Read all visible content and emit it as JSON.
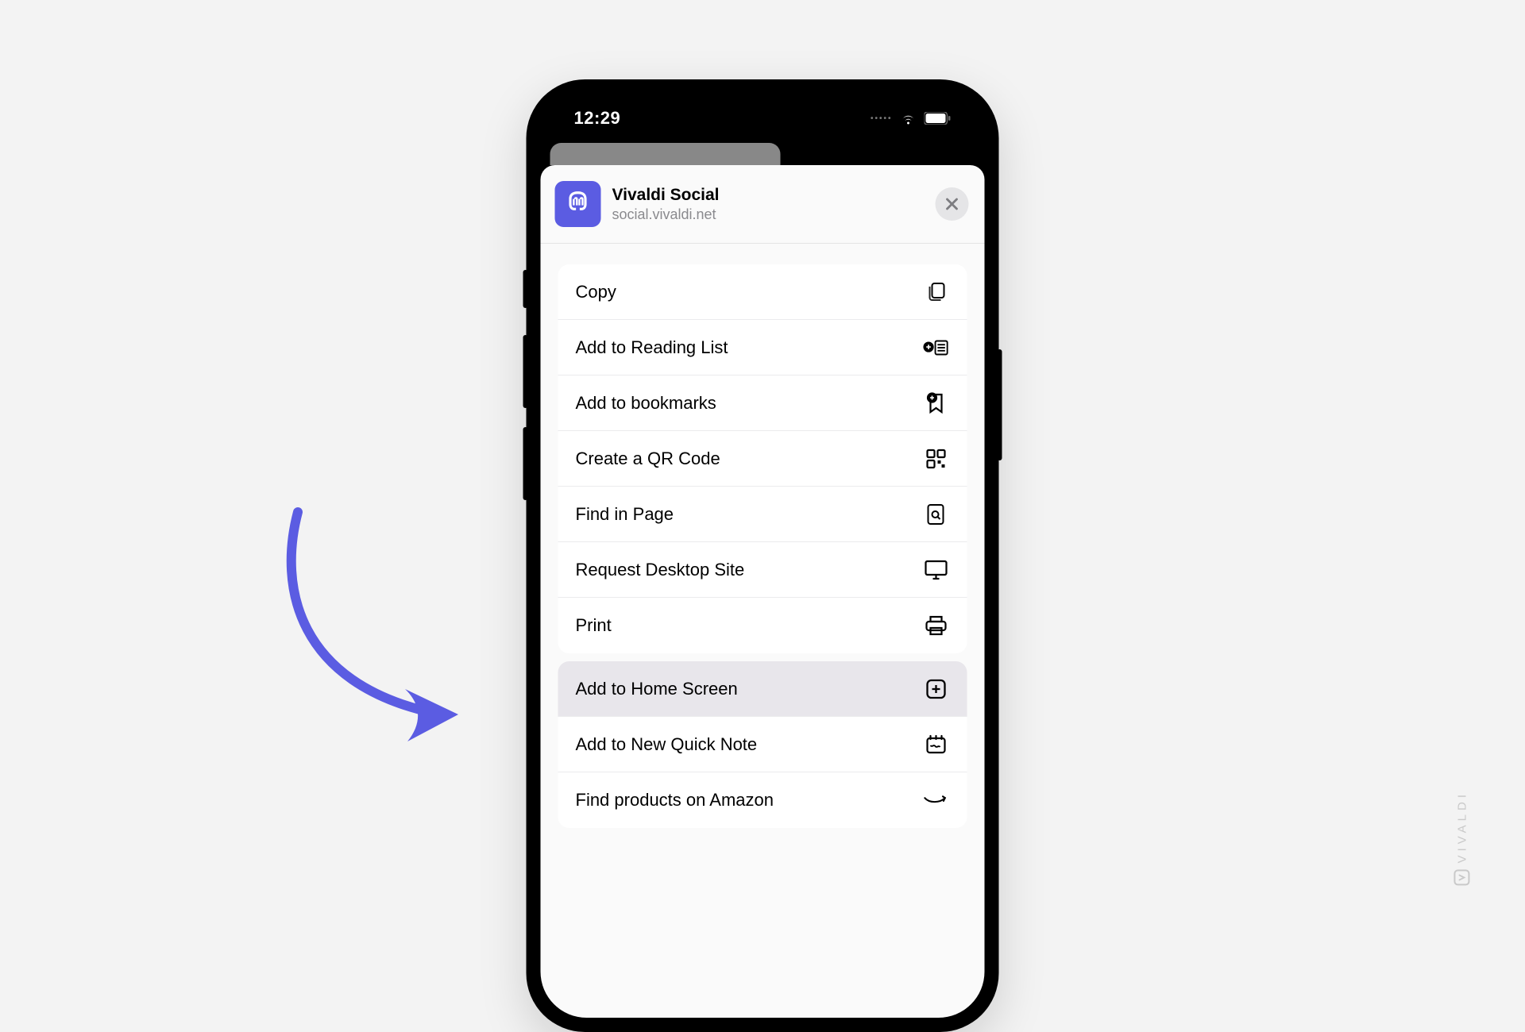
{
  "status": {
    "time": "12:29"
  },
  "sheet": {
    "title": "Vivaldi Social",
    "subtitle": "social.vivaldi.net"
  },
  "group1": {
    "items": [
      {
        "label": "Copy",
        "icon": "copy"
      },
      {
        "label": "Add to Reading List",
        "icon": "reading-list"
      },
      {
        "label": "Add to bookmarks",
        "icon": "bookmark"
      },
      {
        "label": "Create a QR Code",
        "icon": "qr"
      },
      {
        "label": "Find in Page",
        "icon": "find"
      },
      {
        "label": "Request Desktop Site",
        "icon": "desktop"
      },
      {
        "label": "Print",
        "icon": "print"
      }
    ]
  },
  "group2": {
    "items": [
      {
        "label": "Add to Home Screen",
        "icon": "plus-square",
        "highlight": true
      },
      {
        "label": "Add to New Quick Note",
        "icon": "quick-note",
        "highlight": false
      },
      {
        "label": "Find products on Amazon",
        "icon": "amazon",
        "highlight": false
      }
    ]
  },
  "watermark": "VIVALDI"
}
